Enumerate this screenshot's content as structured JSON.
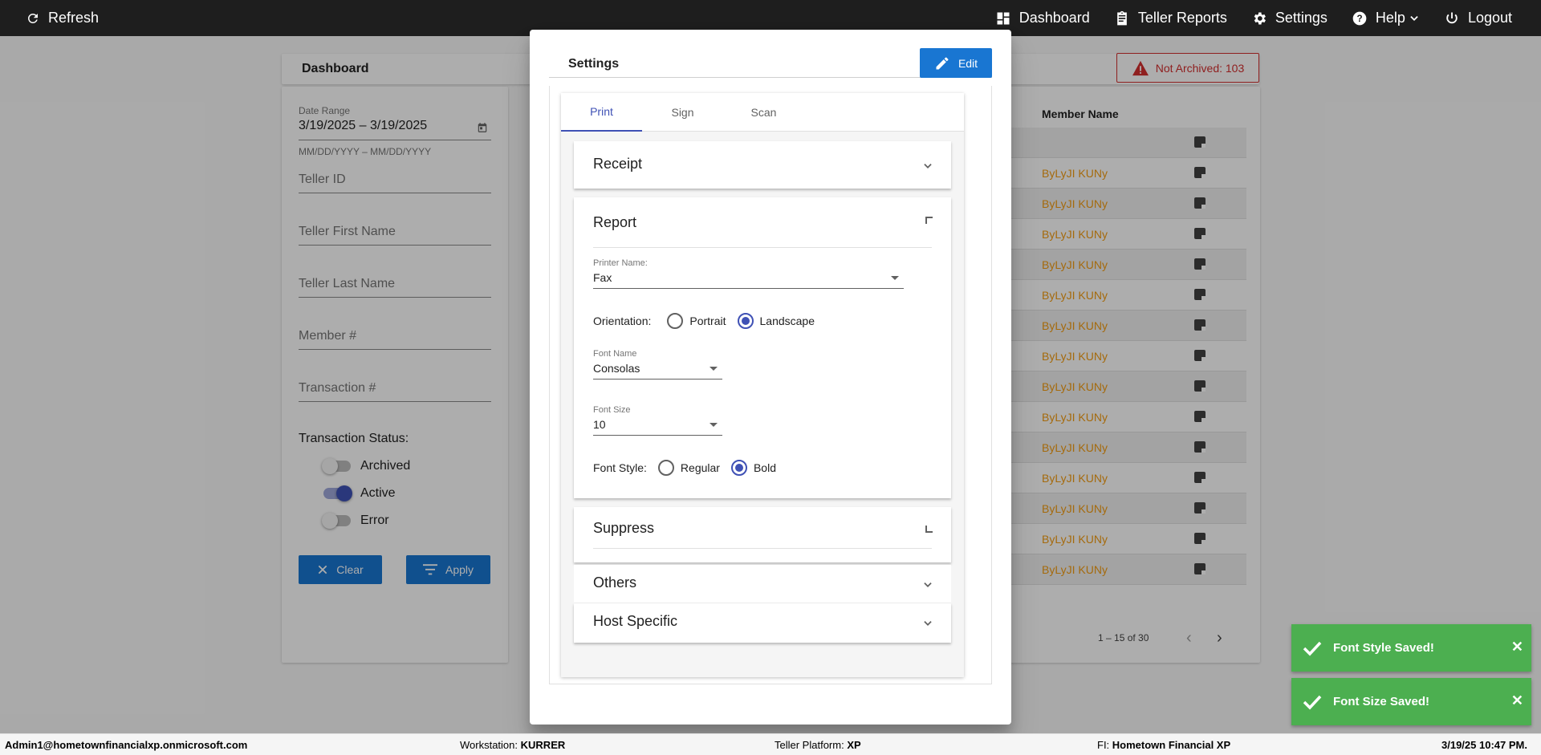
{
  "topbar": {
    "refresh": "Refresh",
    "dashboard": "Dashboard",
    "teller_reports": "Teller Reports",
    "settings": "Settings",
    "help": "Help",
    "logout": "Logout"
  },
  "dashboard": {
    "title": "Dashboard",
    "not_archived": "Not Archived: 103",
    "filters": {
      "date_range_label": "Date Range",
      "date_range_value": "3/19/2025 – 3/19/2025",
      "date_hint": "MM/DD/YYYY – MM/DD/YYYY",
      "teller_id": "Teller ID",
      "teller_first_name": "Teller First Name",
      "teller_last_name": "Teller Last Name",
      "member_no": "Member #",
      "transaction_no": "Transaction #",
      "transaction_status": "Transaction Status:",
      "statuses": [
        {
          "label": "Archived",
          "on": false
        },
        {
          "label": "Active",
          "on": true
        },
        {
          "label": "Error",
          "on": false
        }
      ],
      "clear": "Clear",
      "apply": "Apply"
    },
    "table": {
      "member_name_header": "Member Name",
      "rows": [
        "",
        "ByLyJI KUNy",
        "ByLyJI KUNy",
        "ByLyJI KUNy",
        "ByLyJI KUNy",
        "ByLyJI KUNy",
        "ByLyJI KUNy",
        "ByLyJI KUNy",
        "ByLyJI KUNy",
        "ByLyJI KUNy",
        "ByLyJI KUNy",
        "ByLyJI KUNy",
        "ByLyJI KUNy",
        "ByLyJI KUNy",
        "ByLyJI KUNy"
      ],
      "pager": "1 – 15 of 30"
    }
  },
  "dialog": {
    "title": "Settings",
    "edit": "Edit",
    "tabs": [
      {
        "label": "Print",
        "active": true
      },
      {
        "label": "Sign",
        "active": false
      },
      {
        "label": "Scan",
        "active": false
      }
    ],
    "panels": {
      "receipt": "Receipt",
      "report": "Report",
      "suppress": "Suppress",
      "others": "Others",
      "host_specific": "Host Specific"
    },
    "report": {
      "printer_name_label": "Printer Name:",
      "printer_name_value": "Fax",
      "orientation_label": "Orientation:",
      "orientation_options": [
        "Portrait",
        "Landscape"
      ],
      "orientation_selected": "Landscape",
      "font_name_label": "Font Name",
      "font_name_value": "Consolas",
      "font_size_label": "Font Size",
      "font_size_value": "10",
      "font_style_label": "Font Style:",
      "font_style_options": [
        "Regular",
        "Bold"
      ],
      "font_style_selected": "Bold"
    }
  },
  "toasts": [
    "Font Style Saved!",
    "Font Size Saved!"
  ],
  "statusbar": {
    "user": "Admin1@hometownfinancialxp.onmicrosoft.com",
    "workstation_label": "Workstation:",
    "workstation": "KURRER",
    "platform_label": "Teller Platform:",
    "platform": "XP",
    "fi_label": "FI:",
    "fi": "Hometown Financial XP",
    "datetime": "3/19/25 10:47 PM."
  },
  "colors": {
    "accent": "#3f51b5",
    "primary_button": "#1976d2",
    "toast": "#4caf50",
    "member_name": "#f39c12",
    "alert": "#d32f2f"
  }
}
